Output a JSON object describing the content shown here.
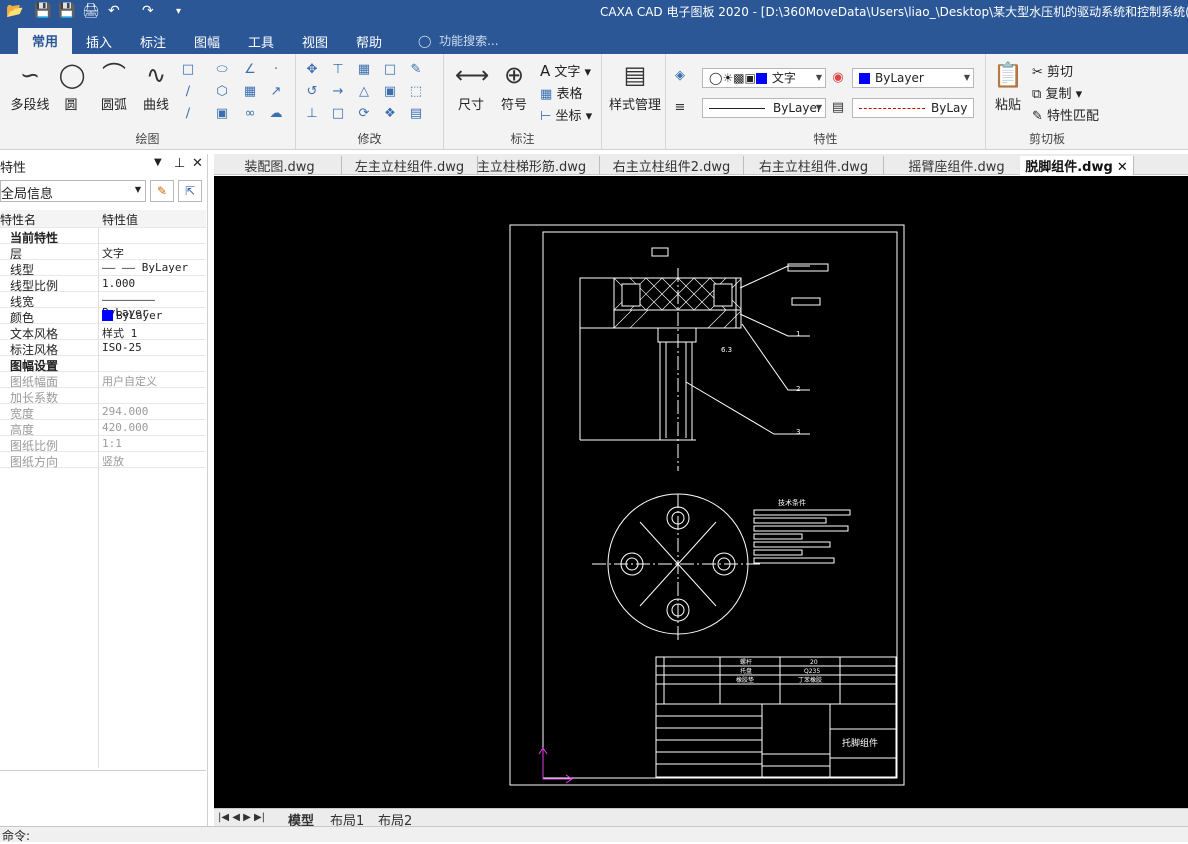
{
  "app": {
    "title": "CAXA CAD 电子图板 2020 - [D:\\360MoveData\\Users\\liao_\\Desktop\\某大型水压机的驱动系统和控制系统(论文"
  },
  "menu": {
    "items": [
      "常用",
      "插入",
      "标注",
      "图幅",
      "工具",
      "视图",
      "帮助"
    ],
    "search_placeholder": "功能搜索..."
  },
  "ribbon": {
    "draw": {
      "label": "绘图",
      "buttons": [
        "多段线",
        "圆",
        "圆弧",
        "曲线"
      ]
    },
    "modify": {
      "label": "修改"
    },
    "annotate": {
      "label": "标注",
      "buttons": [
        "尺寸",
        "符号"
      ],
      "small": [
        "文字",
        "表格",
        "坐标"
      ]
    },
    "style": {
      "button": "样式管理"
    },
    "properties": {
      "label": "特性",
      "text_style": "文字",
      "layer": "ByLayer",
      "linetype": "ByLayer",
      "lineweight": "ByLay",
      "layer_color": "#0000ff"
    },
    "clipboard": {
      "label": "剪切板",
      "paste": "粘贴",
      "cut": "剪切",
      "copy": "复制",
      "match": "特性匹配"
    }
  },
  "panel": {
    "title": "特性",
    "scope": "全局信息",
    "col_name": "特性名",
    "col_value": "特性值",
    "rows": [
      {
        "k": "当前特性",
        "v": "",
        "type": "sec"
      },
      {
        "k": "层",
        "v": "文字"
      },
      {
        "k": "线型",
        "v": "——  —— ByLayer"
      },
      {
        "k": "线型比例",
        "v": "1.000"
      },
      {
        "k": "线宽",
        "v": "———————— ByLayer"
      },
      {
        "k": "颜色",
        "v": "ByLayer",
        "swatch": "#0000ff"
      },
      {
        "k": "文本风格",
        "v": "样式 1"
      },
      {
        "k": "标注风格",
        "v": "ISO-25"
      },
      {
        "k": "图幅设置",
        "v": "",
        "type": "sec"
      },
      {
        "k": "图纸幅面",
        "v": "用户自定义",
        "type": "dis"
      },
      {
        "k": "加长系数",
        "v": "",
        "type": "dis"
      },
      {
        "k": "宽度",
        "v": "294.000",
        "type": "dis"
      },
      {
        "k": "高度",
        "v": "420.000",
        "type": "dis"
      },
      {
        "k": "图纸比例",
        "v": "1:1",
        "type": "dis"
      },
      {
        "k": "图纸方向",
        "v": "竖放",
        "type": "dis"
      }
    ]
  },
  "doc_tabs": [
    "装配图.dwg",
    "左主立柱组件.dwg",
    "主立柱梯形筋.dwg",
    "右主立柱组件2.dwg",
    "右主立柱组件.dwg",
    "摇臂座组件.dwg",
    "脱脚组件.dwg"
  ],
  "active_tab": "脱脚组件.dwg",
  "drawing": {
    "tech_title": "技术条件",
    "part_name": "托脚组件",
    "balloons": [
      "1",
      "2",
      "3"
    ],
    "roughness": "6.3",
    "bom": [
      [
        "螺杆",
        "20"
      ],
      [
        "托盘",
        "Q235"
      ],
      [
        "橡胶垫",
        "丁苯橡胶"
      ]
    ]
  },
  "layout_tabs": [
    "模型",
    "布局1",
    "布局2"
  ],
  "command": "命令:"
}
